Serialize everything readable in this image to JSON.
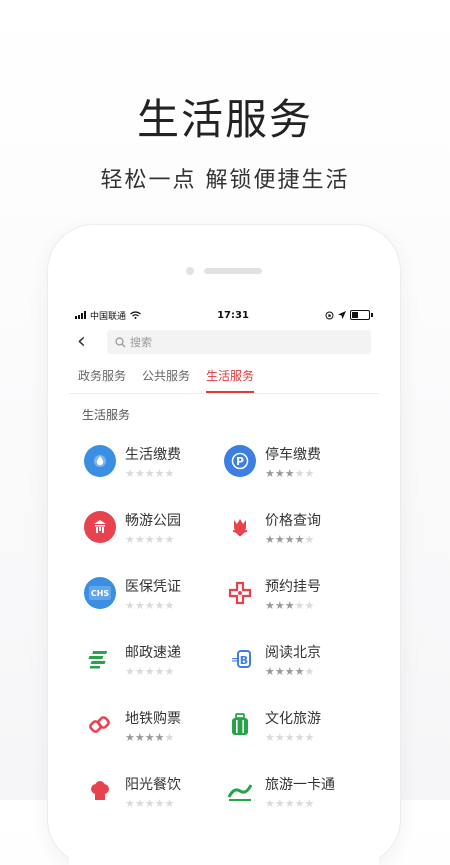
{
  "hero": {
    "title": "生活服务",
    "subtitle": "轻松一点 解锁便捷生活"
  },
  "status": {
    "carrier": "中国联通",
    "time": "17:31"
  },
  "search": {
    "placeholder": "搜索"
  },
  "tabs": [
    {
      "label": "政务服务",
      "active": false
    },
    {
      "label": "公共服务",
      "active": false
    },
    {
      "label": "生活服务",
      "active": true
    }
  ],
  "section": {
    "title": "生活服务"
  },
  "services": [
    {
      "name": "生活缴费",
      "icon": "droplet-icon",
      "rating": 0,
      "color": "#3b8fe3"
    },
    {
      "name": "停车缴费",
      "icon": "parking-icon",
      "rating": 3,
      "color": "#3d7fe0"
    },
    {
      "name": "畅游公园",
      "icon": "park-icon",
      "rating": 0,
      "color": "#e8424e"
    },
    {
      "name": "价格查询",
      "icon": "tulip-icon",
      "rating": 4,
      "color": "#e8424e"
    },
    {
      "name": "医保凭证",
      "icon": "medical-insurance-icon",
      "rating": 0,
      "color": "#3b8fe3"
    },
    {
      "name": "预约挂号",
      "icon": "hospital-cross-icon",
      "rating": 3,
      "color": "#e8424e"
    },
    {
      "name": "邮政速递",
      "icon": "post-icon",
      "rating": 0,
      "color": "#27a34a"
    },
    {
      "name": "阅读北京",
      "icon": "book-icon",
      "rating": 4,
      "color": "#3d7fe0"
    },
    {
      "name": "地铁购票",
      "icon": "metro-icon",
      "rating": 4,
      "color": "#e8424e"
    },
    {
      "name": "文化旅游",
      "icon": "suitcase-icon",
      "rating": 0,
      "color": "#27a34a"
    },
    {
      "name": "阳光餐饮",
      "icon": "chef-hat-icon",
      "rating": 0,
      "color": "#e8424e"
    },
    {
      "name": "旅游一卡通",
      "icon": "card-icon",
      "rating": 0,
      "color": "#27a34a"
    }
  ]
}
